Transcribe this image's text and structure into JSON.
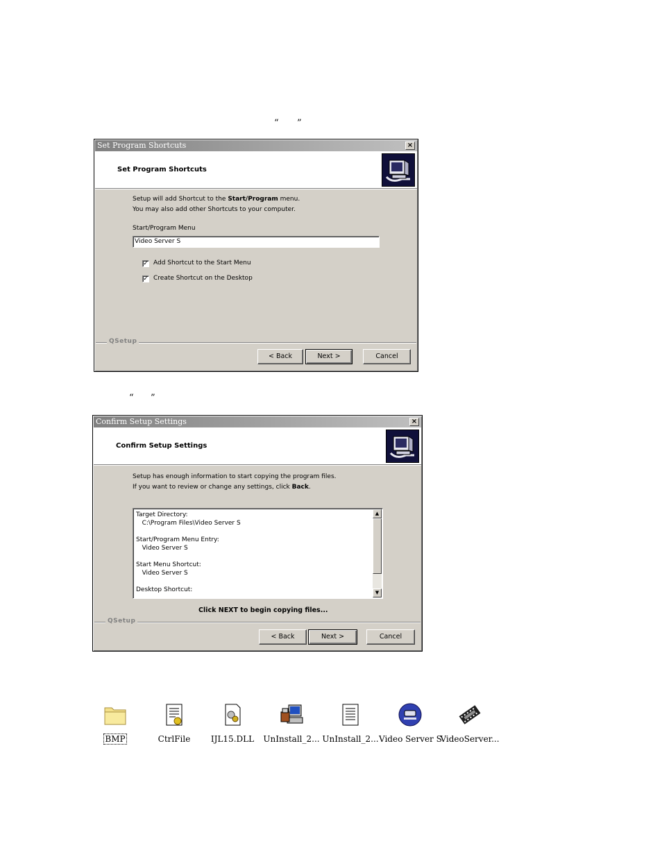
{
  "quotes": {
    "open": "“",
    "close": "”"
  },
  "dialog1": {
    "window_title": "Set Program Shortcuts",
    "close_glyph": "×",
    "header_title": "Set Program Shortcuts",
    "intro_line1_pre": "Setup will add Shortcut to the ",
    "intro_line1_bold": "Start/Program",
    "intro_line1_post": " menu.",
    "intro_line2": "You may also add other Shortcuts to your computer.",
    "menu_label": "Start/Program Menu",
    "menu_value": "Video Server S",
    "checkbox1_label": "Add Shortcut to the Start Menu",
    "checkbox1_checked": true,
    "checkbox2_label": "Create Shortcut on the Desktop",
    "checkbox2_checked": true,
    "brand": "QSetup",
    "back_label": "< Back",
    "next_label": "Next >",
    "cancel_label": "Cancel"
  },
  "dialog2": {
    "window_title": "Confirm Setup Settings",
    "close_glyph": "×",
    "header_title": "Confirm Setup Settings",
    "intro_line1": "Setup has enough information to start copying the program files.",
    "intro_line2_pre": "If you want to review or change any settings, click ",
    "intro_line2_bold": "Back",
    "intro_line2_post": ".",
    "summary": "Target Directory:\n   C:\\Program Files\\Video Server S\n\nStart/Program Menu Entry:\n   Video Server S\n\nStart Menu Shortcut:\n   Video Server S\n\nDesktop Shortcut:",
    "scroll_up": "▲",
    "scroll_down": "▼",
    "message": "Click NEXT to begin copying files...",
    "brand": "QSetup",
    "back_label": "< Back",
    "next_label": "Next >",
    "cancel_label": "Cancel"
  },
  "files": [
    {
      "label": "BMP",
      "icon": "folder-icon"
    },
    {
      "label": "CtrlFile",
      "icon": "config-file-icon"
    },
    {
      "label": "IJL15.DLL",
      "icon": "dll-file-icon"
    },
    {
      "label": "UnInstall_2...",
      "icon": "uninstall-program-icon"
    },
    {
      "label": "UnInstall_2...",
      "icon": "text-document-icon"
    },
    {
      "label": "Video Server S",
      "icon": "video-server-app-icon"
    },
    {
      "label": "VideoServer...",
      "icon": "video-film-icon"
    }
  ]
}
